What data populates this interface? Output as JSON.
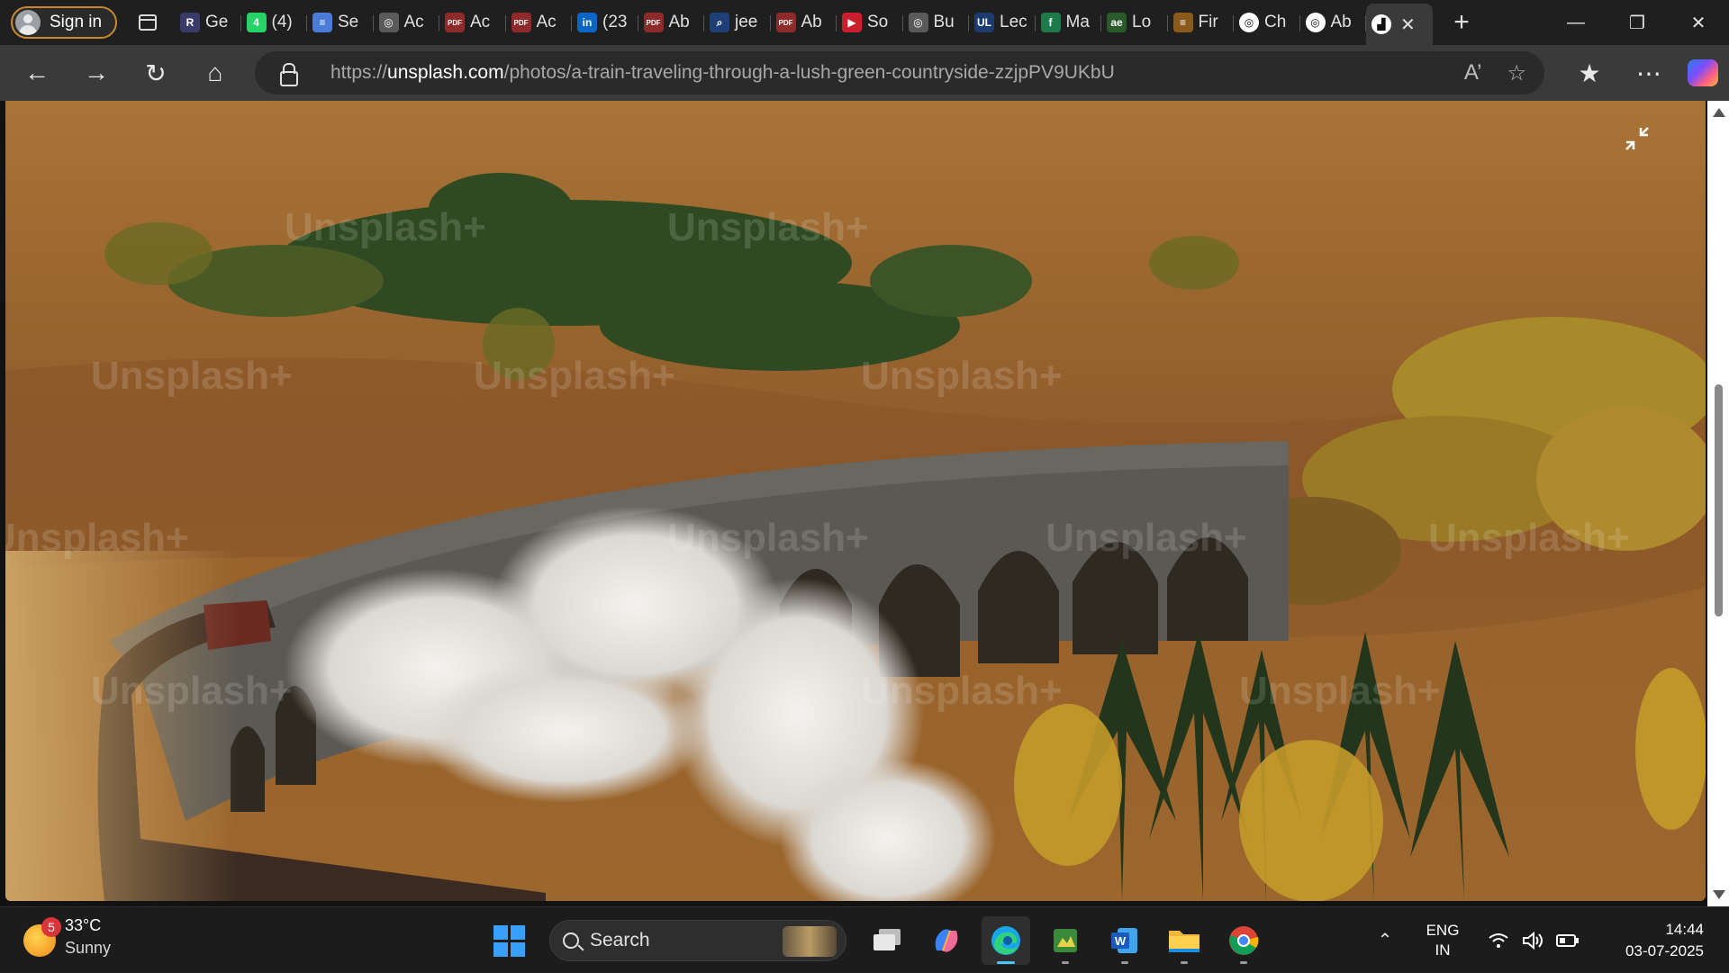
{
  "browser": {
    "signin_label": "Sign in",
    "tabs": [
      {
        "icon": "r-icon",
        "color": "#3b3b6b",
        "glyph": "R",
        "title": "Ge"
      },
      {
        "icon": "whatsapp-icon",
        "color": "#25d366",
        "glyph": "4",
        "title": "(4)"
      },
      {
        "icon": "docs-icon",
        "color": "#4a7bd8",
        "glyph": "≡",
        "title": "Se"
      },
      {
        "icon": "openai-icon",
        "color": "#5a5a5a",
        "glyph": "◎",
        "title": "Ac"
      },
      {
        "icon": "pdf-icon",
        "color": "#8e2a2a",
        "glyph": "PDF",
        "title": "Ac"
      },
      {
        "icon": "pdf-icon",
        "color": "#8e2a2a",
        "glyph": "PDF",
        "title": "Ac"
      },
      {
        "icon": "linkedin-icon",
        "color": "#0a66c2",
        "glyph": "in",
        "title": "(23"
      },
      {
        "icon": "pdf-icon",
        "color": "#8e2a2a",
        "glyph": "PDF",
        "title": "Ab"
      },
      {
        "icon": "search-icon",
        "color": "#1f3f77",
        "glyph": "⌕",
        "title": "jee"
      },
      {
        "icon": "pdf-icon",
        "color": "#8e2a2a",
        "glyph": "PDF",
        "title": "Ab"
      },
      {
        "icon": "youtube-icon",
        "color": "#cc1f2d",
        "glyph": "▶",
        "title": "So"
      },
      {
        "icon": "openai-icon",
        "color": "#5a5a5a",
        "glyph": "◎",
        "title": "Bu"
      },
      {
        "icon": "ul-icon",
        "color": "#1e3b70",
        "glyph": "UL",
        "title": "Lec"
      },
      {
        "icon": "leaf-icon",
        "color": "#1f7a4a",
        "glyph": "f",
        "title": "Ma"
      },
      {
        "icon": "ae-icon",
        "color": "#2a5a2a",
        "glyph": "ae",
        "title": "Lo"
      },
      {
        "icon": "stack-icon",
        "color": "#8a5a1a",
        "glyph": "≡",
        "title": "Fir"
      },
      {
        "icon": "chatgpt-icon",
        "color": "#ffffff",
        "glyph": "◎",
        "title": "Ch"
      },
      {
        "icon": "chatgpt-icon",
        "color": "#ffffff",
        "glyph": "◎",
        "title": "Ab"
      },
      {
        "icon": "unsplash-icon",
        "color": "#ffffff",
        "glyph": "▟",
        "title": "",
        "active": true
      }
    ],
    "url_prefix": "https://",
    "url_host": "unsplash.com",
    "url_path": "/photos/a-train-traveling-through-a-lush-green-countryside-zzjpPV9UKbU"
  },
  "photo": {
    "alt": "a train traveling through a lush green countryside",
    "watermark": "Unsplash+"
  },
  "taskbar": {
    "weather_badge": "5",
    "temperature": "33°C",
    "condition": "Sunny",
    "search_label": "Search",
    "lang_line1": "ENG",
    "lang_line2": "IN",
    "time": "14:44",
    "date": "03-07-2025"
  }
}
